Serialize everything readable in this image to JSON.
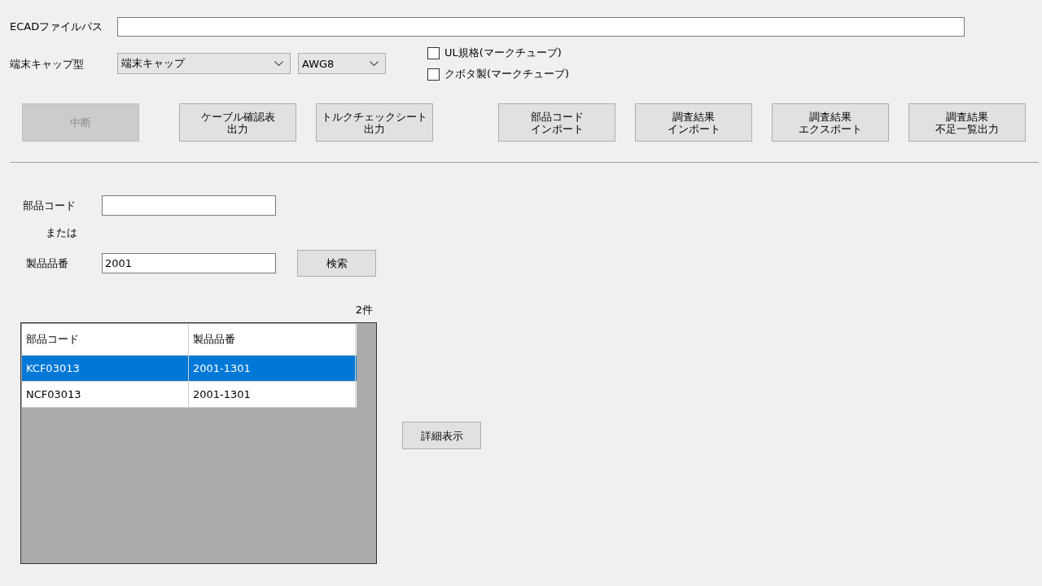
{
  "ecad_path": {
    "label": "ECADファイルパス"
  },
  "terminal_cap": {
    "label": "端末キャップ型",
    "dropdowns": [
      {
        "value": "端末キャップ"
      },
      {
        "value": "AWG8"
      }
    ]
  },
  "checkboxes": [
    {
      "label": "UL規格(マークチューブ)",
      "checked": false
    },
    {
      "label": "クボタ製(マークチューブ)",
      "checked": false
    }
  ],
  "buttons": [
    {
      "lines": [
        "中断"
      ],
      "disabled": true
    },
    {
      "lines": [
        "ケーブル確認表",
        "出力"
      ],
      "disabled": false
    },
    {
      "lines": [
        "トルクチェックシート",
        "出力"
      ],
      "disabled": false
    },
    {
      "lines": [
        "部品コード",
        "インポート"
      ],
      "disabled": false
    },
    {
      "lines": [
        "調査結果",
        "インポート"
      ],
      "disabled": false
    },
    {
      "lines": [
        "調査結果",
        "エクスポート"
      ],
      "disabled": false
    },
    {
      "lines": [
        "調査結果",
        "不足一覧出力"
      ],
      "disabled": false
    }
  ],
  "search": {
    "part_code": {
      "label": "部品コード"
    },
    "or_text": "または",
    "product_number": {
      "label": "製品品番",
      "value": "2001"
    },
    "search_button": "検索"
  },
  "result_count": "2件",
  "table": {
    "columns": [
      "部品コード",
      "製品品番"
    ],
    "rows": [
      {
        "cells": [
          "KCF03013",
          "2001-1301"
        ],
        "selected": true
      },
      {
        "cells": [
          "NCF03013",
          "2001-1301"
        ],
        "selected": false
      }
    ]
  },
  "detail_button": "詳細表示"
}
